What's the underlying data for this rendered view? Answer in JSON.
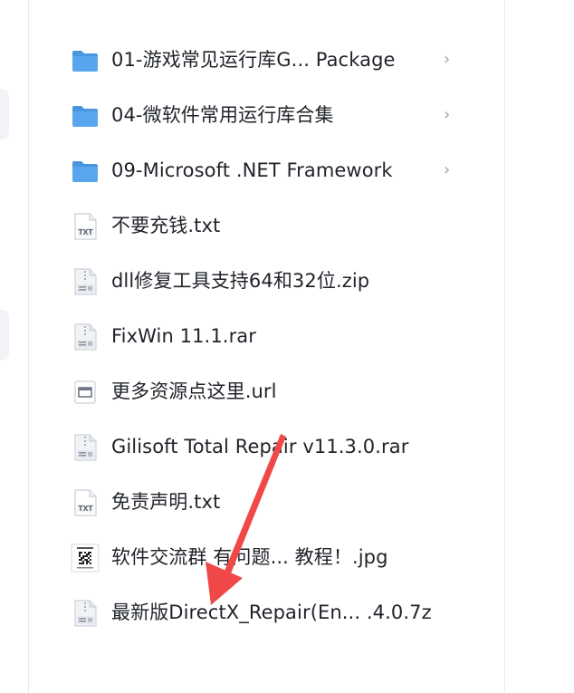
{
  "files": [
    {
      "name": "01-游戏常见运行库G... Package",
      "type": "folder",
      "icon": "folder-icon",
      "chevron": "›"
    },
    {
      "name": "04-微软件常用运行库合集",
      "type": "folder",
      "icon": "folder-icon",
      "chevron": "›"
    },
    {
      "name": "09-Microsoft .NET Framework",
      "type": "folder",
      "icon": "folder-icon",
      "chevron": "›"
    },
    {
      "name": "不要充钱.txt",
      "type": "txt",
      "icon": "txt-file-icon",
      "badge": "TXT"
    },
    {
      "name": "dll修复工具支持64和32位.zip",
      "type": "archive",
      "icon": "archive-file-icon"
    },
    {
      "name": "FixWin 11.1.rar",
      "type": "archive",
      "icon": "archive-file-icon"
    },
    {
      "name": "更多资源点这里.url",
      "type": "url",
      "icon": "url-file-icon"
    },
    {
      "name": "Gilisoft Total Repair v11.3.0.rar",
      "type": "archive",
      "icon": "archive-file-icon"
    },
    {
      "name": "免责声明.txt",
      "type": "txt",
      "icon": "txt-file-icon",
      "badge": "TXT"
    },
    {
      "name": "软件交流群    有问题...    教程！.jpg",
      "type": "image",
      "icon": "qr-image-icon"
    },
    {
      "name": "最新版DirectX_Repair(En...  .4.0.7z",
      "type": "archive",
      "icon": "archive-file-icon"
    }
  ],
  "colors": {
    "folder": "#5aa6ee",
    "folder_back": "#4a95e0",
    "arrow": "#f04848",
    "text": "#1f2329"
  }
}
